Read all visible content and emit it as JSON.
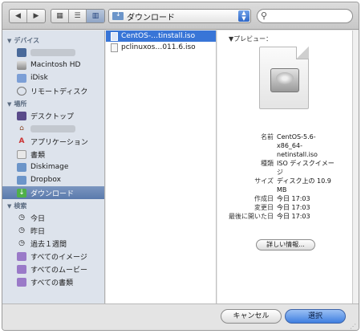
{
  "toolbar": {
    "location": "ダウンロード",
    "search_placeholder": ""
  },
  "sidebar": {
    "devices_header": "デバイス",
    "devices": [
      {
        "label": "",
        "icon": "display-icon"
      },
      {
        "label": "Macintosh HD",
        "icon": "hard-drive-icon"
      },
      {
        "label": "iDisk",
        "icon": "idisk-icon"
      },
      {
        "label": "リモートディスク",
        "icon": "remote-disc-icon"
      }
    ],
    "places_header": "場所",
    "places": [
      {
        "label": "デスクトップ",
        "icon": "desktop-icon"
      },
      {
        "label": "",
        "icon": "home-icon"
      },
      {
        "label": "アプリケーション",
        "icon": "applications-icon"
      },
      {
        "label": "書類",
        "icon": "documents-icon"
      },
      {
        "label": "Diskimage",
        "icon": "folder-icon"
      },
      {
        "label": "Dropbox",
        "icon": "folder-icon"
      },
      {
        "label": "ダウンロード",
        "icon": "downloads-icon"
      }
    ],
    "search_header": "検索",
    "searches": [
      {
        "label": "今日",
        "icon": "clock-icon"
      },
      {
        "label": "昨日",
        "icon": "clock-icon"
      },
      {
        "label": "過去１週間",
        "icon": "clock-icon"
      },
      {
        "label": "すべてのイメージ",
        "icon": "smart-folder-icon"
      },
      {
        "label": "すべてのムービー",
        "icon": "smart-folder-icon"
      },
      {
        "label": "すべての書類",
        "icon": "smart-folder-icon"
      }
    ]
  },
  "files": [
    {
      "name": "CentOS-…tinstall.iso",
      "selected": true
    },
    {
      "name": "pclinuxos…011.6.iso",
      "selected": false
    }
  ],
  "preview": {
    "title": "プレビュー：",
    "fields": [
      {
        "key": "名前",
        "value": "CentOS-5.6-"
      },
      {
        "key": "",
        "value": "x86_64-"
      },
      {
        "key": "",
        "value": "netinstall.iso"
      },
      {
        "key": "種類",
        "value": "ISO ディスクイメー"
      },
      {
        "key": "",
        "value": "ジ"
      },
      {
        "key": "サイズ",
        "value": "ディスク上の 10.9"
      },
      {
        "key": "",
        "value": "MB"
      },
      {
        "key": "作成日",
        "value": "今日 17:03"
      },
      {
        "key": "変更日",
        "value": "今日 17:03"
      },
      {
        "key": "最後に開いた日",
        "value": "今日 17:03"
      }
    ],
    "more_label": "詳しい情報..."
  },
  "buttons": {
    "cancel": "キャンセル",
    "open": "選択"
  },
  "colors": {
    "selection": "#3875d7",
    "sidebar_bg": "#dde3ec",
    "primary_button": "#3f7fe0"
  }
}
